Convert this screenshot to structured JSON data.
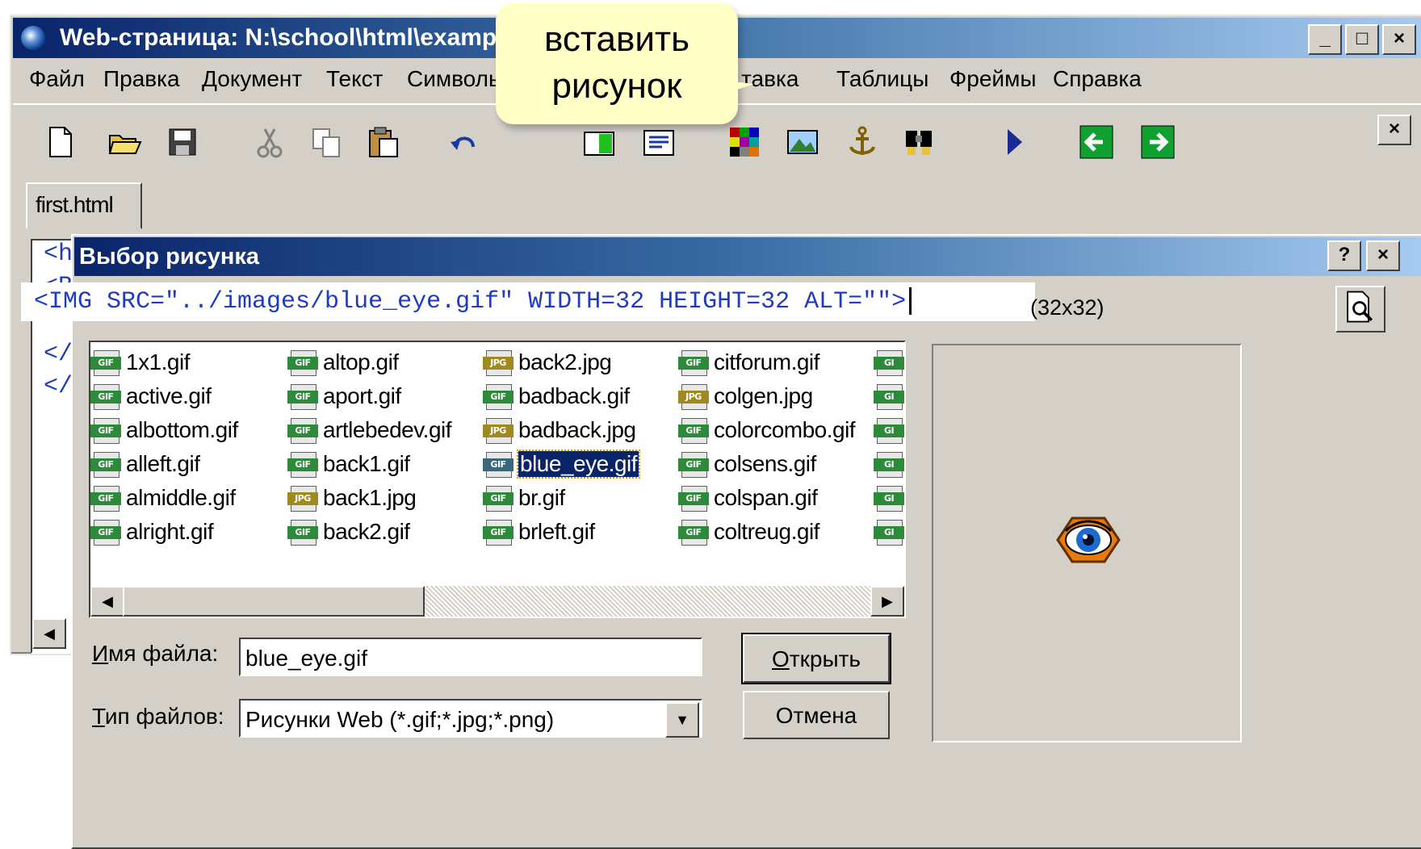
{
  "window": {
    "title": "Web-страница: N:\\school\\html\\examp",
    "controls": [
      "_",
      "□",
      "×"
    ]
  },
  "menu": [
    "Файл",
    "Правка",
    "Документ",
    "Текст",
    "Символы",
    "тавка",
    "Таблицы",
    "Фреймы",
    "Справка"
  ],
  "toolbar": {
    "close": "×",
    "icons": [
      "new-document-icon",
      "open-folder-icon",
      "save-icon",
      "cut-icon",
      "copy-icon",
      "paste-icon",
      "undo-icon",
      "table-icon",
      "paragraph-icon",
      "color-palette-icon",
      "image-icon",
      "anchor-icon",
      "search-icon",
      "play-icon",
      "back-arrow-icon",
      "forward-arrow-icon"
    ]
  },
  "tab": "first.html",
  "editor": {
    "lines": [
      "<ht",
      "<B",
      "",
      "</",
      "</"
    ]
  },
  "callout": {
    "line1": "вставить",
    "line2": "рисунок"
  },
  "dialog": {
    "title": "Выбор рисунка",
    "help": "?",
    "close": "×",
    "img_tag": "<IMG SRC=\"../images/blue_eye.gif\" WIDTH=32 HEIGHT=32 ALT=\"\">",
    "dimensions": "(32x32)",
    "files": [
      [
        {
          "name": "1x1.gif",
          "type": "GIF"
        },
        {
          "name": "active.gif",
          "type": "GIF"
        },
        {
          "name": "albottom.gif",
          "type": "GIF"
        },
        {
          "name": "alleft.gif",
          "type": "GIF"
        },
        {
          "name": "almiddle.gif",
          "type": "GIF"
        },
        {
          "name": "alright.gif",
          "type": "GIF"
        }
      ],
      [
        {
          "name": "altop.gif",
          "type": "GIF"
        },
        {
          "name": "aport.gif",
          "type": "GIF"
        },
        {
          "name": "artlebedev.gif",
          "type": "GIF"
        },
        {
          "name": "back1.gif",
          "type": "GIF"
        },
        {
          "name": "back1.jpg",
          "type": "JPG"
        },
        {
          "name": "back2.gif",
          "type": "GIF"
        }
      ],
      [
        {
          "name": "back2.jpg",
          "type": "JPG"
        },
        {
          "name": "badback.gif",
          "type": "GIF"
        },
        {
          "name": "badback.jpg",
          "type": "JPG"
        },
        {
          "name": "blue_eye.gif",
          "type": "GIF",
          "selected": true
        },
        {
          "name": "br.gif",
          "type": "GIF"
        },
        {
          "name": "brleft.gif",
          "type": "GIF"
        }
      ],
      [
        {
          "name": "citforum.gif",
          "type": "GIF"
        },
        {
          "name": "colgen.jpg",
          "type": "JPG"
        },
        {
          "name": "colorcombo.gif",
          "type": "GIF"
        },
        {
          "name": "colsens.gif",
          "type": "GIF"
        },
        {
          "name": "colspan.gif",
          "type": "GIF"
        },
        {
          "name": "coltreug.gif",
          "type": "GIF"
        }
      ]
    ],
    "filename_label_u": "И",
    "filename_label_rest": "мя файла:",
    "filename_value": "blue_eye.gif",
    "filetype_label_u": "Т",
    "filetype_label_rest": "ип файлов:",
    "filetype_value": "Рисунки Web (*.gif;*.jpg;*.png)",
    "open_u": "О",
    "open_rest": "ткрыть",
    "cancel": "Отмена"
  },
  "colors": {
    "title_gradient_start": "#0a246a",
    "selection": "#0a246a",
    "gif_badge": "#2c8a3a",
    "jpg_badge": "#a08a20",
    "callout": "#ffffc6"
  }
}
